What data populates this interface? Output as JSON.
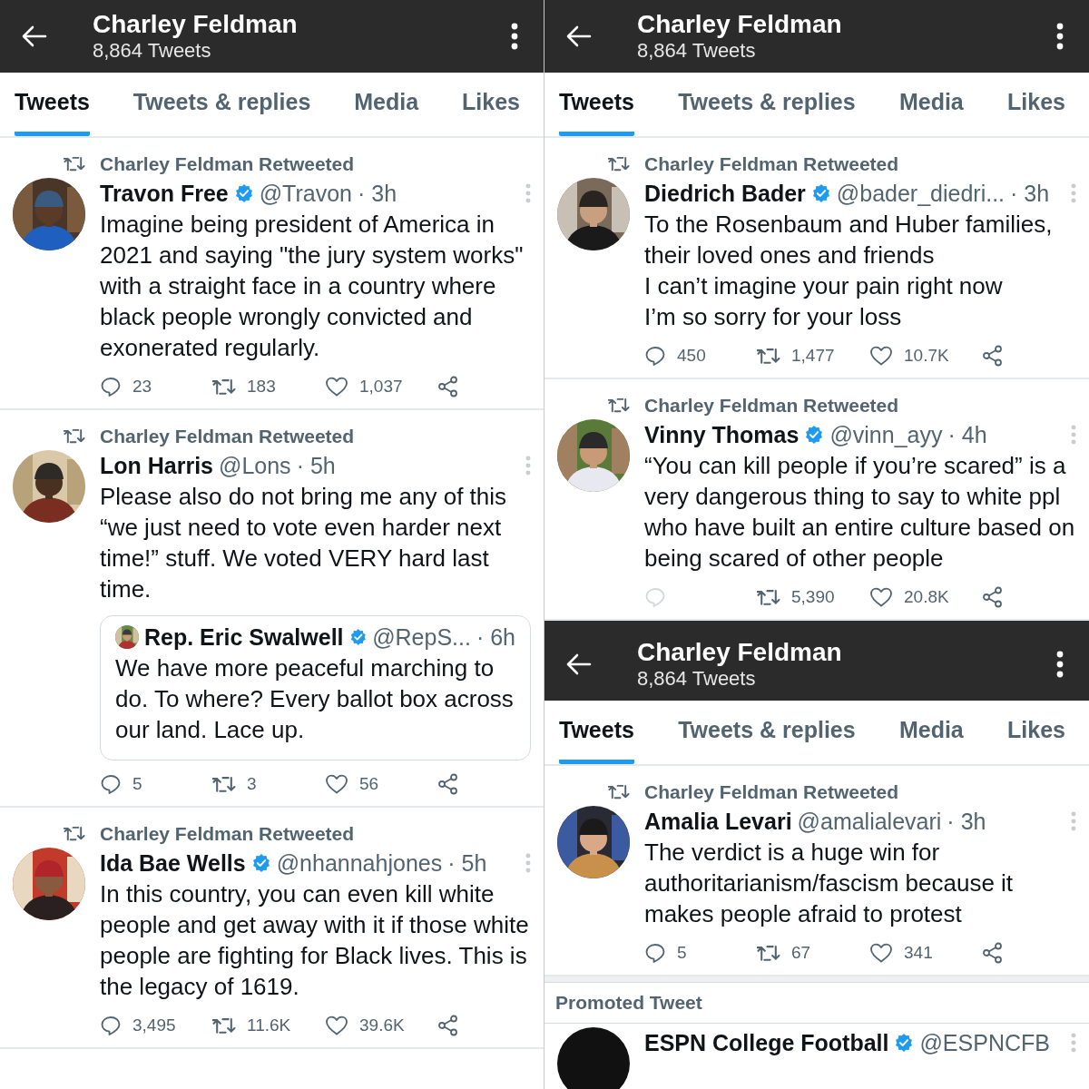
{
  "panels": [
    {
      "header": {
        "title": "Charley Feldman",
        "subtitle": "8,864 Tweets"
      },
      "tabs": [
        {
          "label": "Tweets",
          "selected": true
        },
        {
          "label": "Tweets & replies",
          "selected": false
        },
        {
          "label": "Media",
          "selected": false
        },
        {
          "label": "Likes",
          "selected": false
        }
      ],
      "feed": [
        {
          "kind": "tweet",
          "retweeted_by": "Charley Feldman Retweeted",
          "name": "Travon Free",
          "verified": true,
          "handle": "@Travon",
          "time": "· 3h",
          "text": "Imagine being president of America in 2021 and saying \"the jury system works\" with a straight face in a country where black people wrongly convicted and exonerated regularly.",
          "replies_enabled": true,
          "replies": "23",
          "retweets": "183",
          "likes": "1,037"
        },
        {
          "kind": "tweet",
          "retweeted_by": "Charley Feldman Retweeted",
          "name": "Lon Harris",
          "verified": false,
          "handle": "@Lons",
          "time": "· 5h",
          "text": "Please also do not bring me any of this “we just need to vote even harder next time!” stuff. We voted VERY hard last time.",
          "quote": {
            "name": "Rep. Eric Swalwell",
            "verified": true,
            "handle": "@RepS...",
            "time": "· 6h",
            "text": "We have more peaceful marching to do. To where? Every ballot box across our land. Lace up."
          },
          "replies_enabled": true,
          "replies": "5",
          "retweets": "3",
          "likes": "56"
        },
        {
          "kind": "tweet",
          "retweeted_by": "Charley Feldman Retweeted",
          "name": "Ida Bae Wells",
          "verified": true,
          "handle": "@nhannahjones",
          "time": "· 5h",
          "text": "In this country, you can even kill white people and get away with it if those white people are fighting for Black lives. This is the legacy of 1619.",
          "replies_enabled": true,
          "replies": "3,495",
          "retweets": "11.6K",
          "likes": "39.6K"
        }
      ]
    },
    {
      "header": {
        "title": "Charley Feldman",
        "subtitle": "8,864 Tweets"
      },
      "tabs": [
        {
          "label": "Tweets",
          "selected": true
        },
        {
          "label": "Tweets & replies",
          "selected": false
        },
        {
          "label": "Media",
          "selected": false
        },
        {
          "label": "Likes",
          "selected": false
        }
      ],
      "feed": [
        {
          "kind": "tweet",
          "retweeted_by": "Charley Feldman Retweeted",
          "name": "Diedrich Bader",
          "verified": true,
          "handle": "@bader_diedri...",
          "time": " · 3h",
          "text": "To the Rosenbaum and Huber families,\ntheir loved ones and friends\nI can’t imagine your pain right now\nI’m so sorry for your loss",
          "replies_enabled": true,
          "replies": "450",
          "retweets": "1,477",
          "likes": "10.7K"
        },
        {
          "kind": "tweet",
          "retweeted_by": "Charley Feldman Retweeted",
          "name": "Vinny Thomas",
          "verified": true,
          "handle": "@vinn_ayy",
          "time": "· 4h",
          "text": "“You can kill people if you’re scared” is a very dangerous thing to say to white ppl who have built an entire culture based on being scared of other people",
          "replies_enabled": false,
          "retweets": "5,390",
          "likes": "20.8K"
        }
      ]
    },
    {
      "header": {
        "title": "Charley Feldman",
        "subtitle": "8,864 Tweets"
      },
      "tabs": [
        {
          "label": "Tweets",
          "selected": true
        },
        {
          "label": "Tweets & replies",
          "selected": false
        },
        {
          "label": "Media",
          "selected": false
        },
        {
          "label": "Likes",
          "selected": false
        }
      ],
      "feed": [
        {
          "kind": "tweet",
          "retweeted_by": "Charley Feldman Retweeted",
          "name": "Amalia Levari",
          "verified": false,
          "handle": "@amalialevari",
          "time": "· 3h",
          "text": "The verdict is a huge win for authoritarianism/fascism because it makes people afraid to protest",
          "replies_enabled": true,
          "replies": "5",
          "retweets": "67",
          "likes": "341"
        },
        {
          "kind": "promoted_label",
          "text": "Promoted Tweet"
        },
        {
          "kind": "promoted_tweet",
          "name": "ESPN College Football",
          "verified": true,
          "handle": "@ESPNCFB"
        }
      ]
    }
  ]
}
